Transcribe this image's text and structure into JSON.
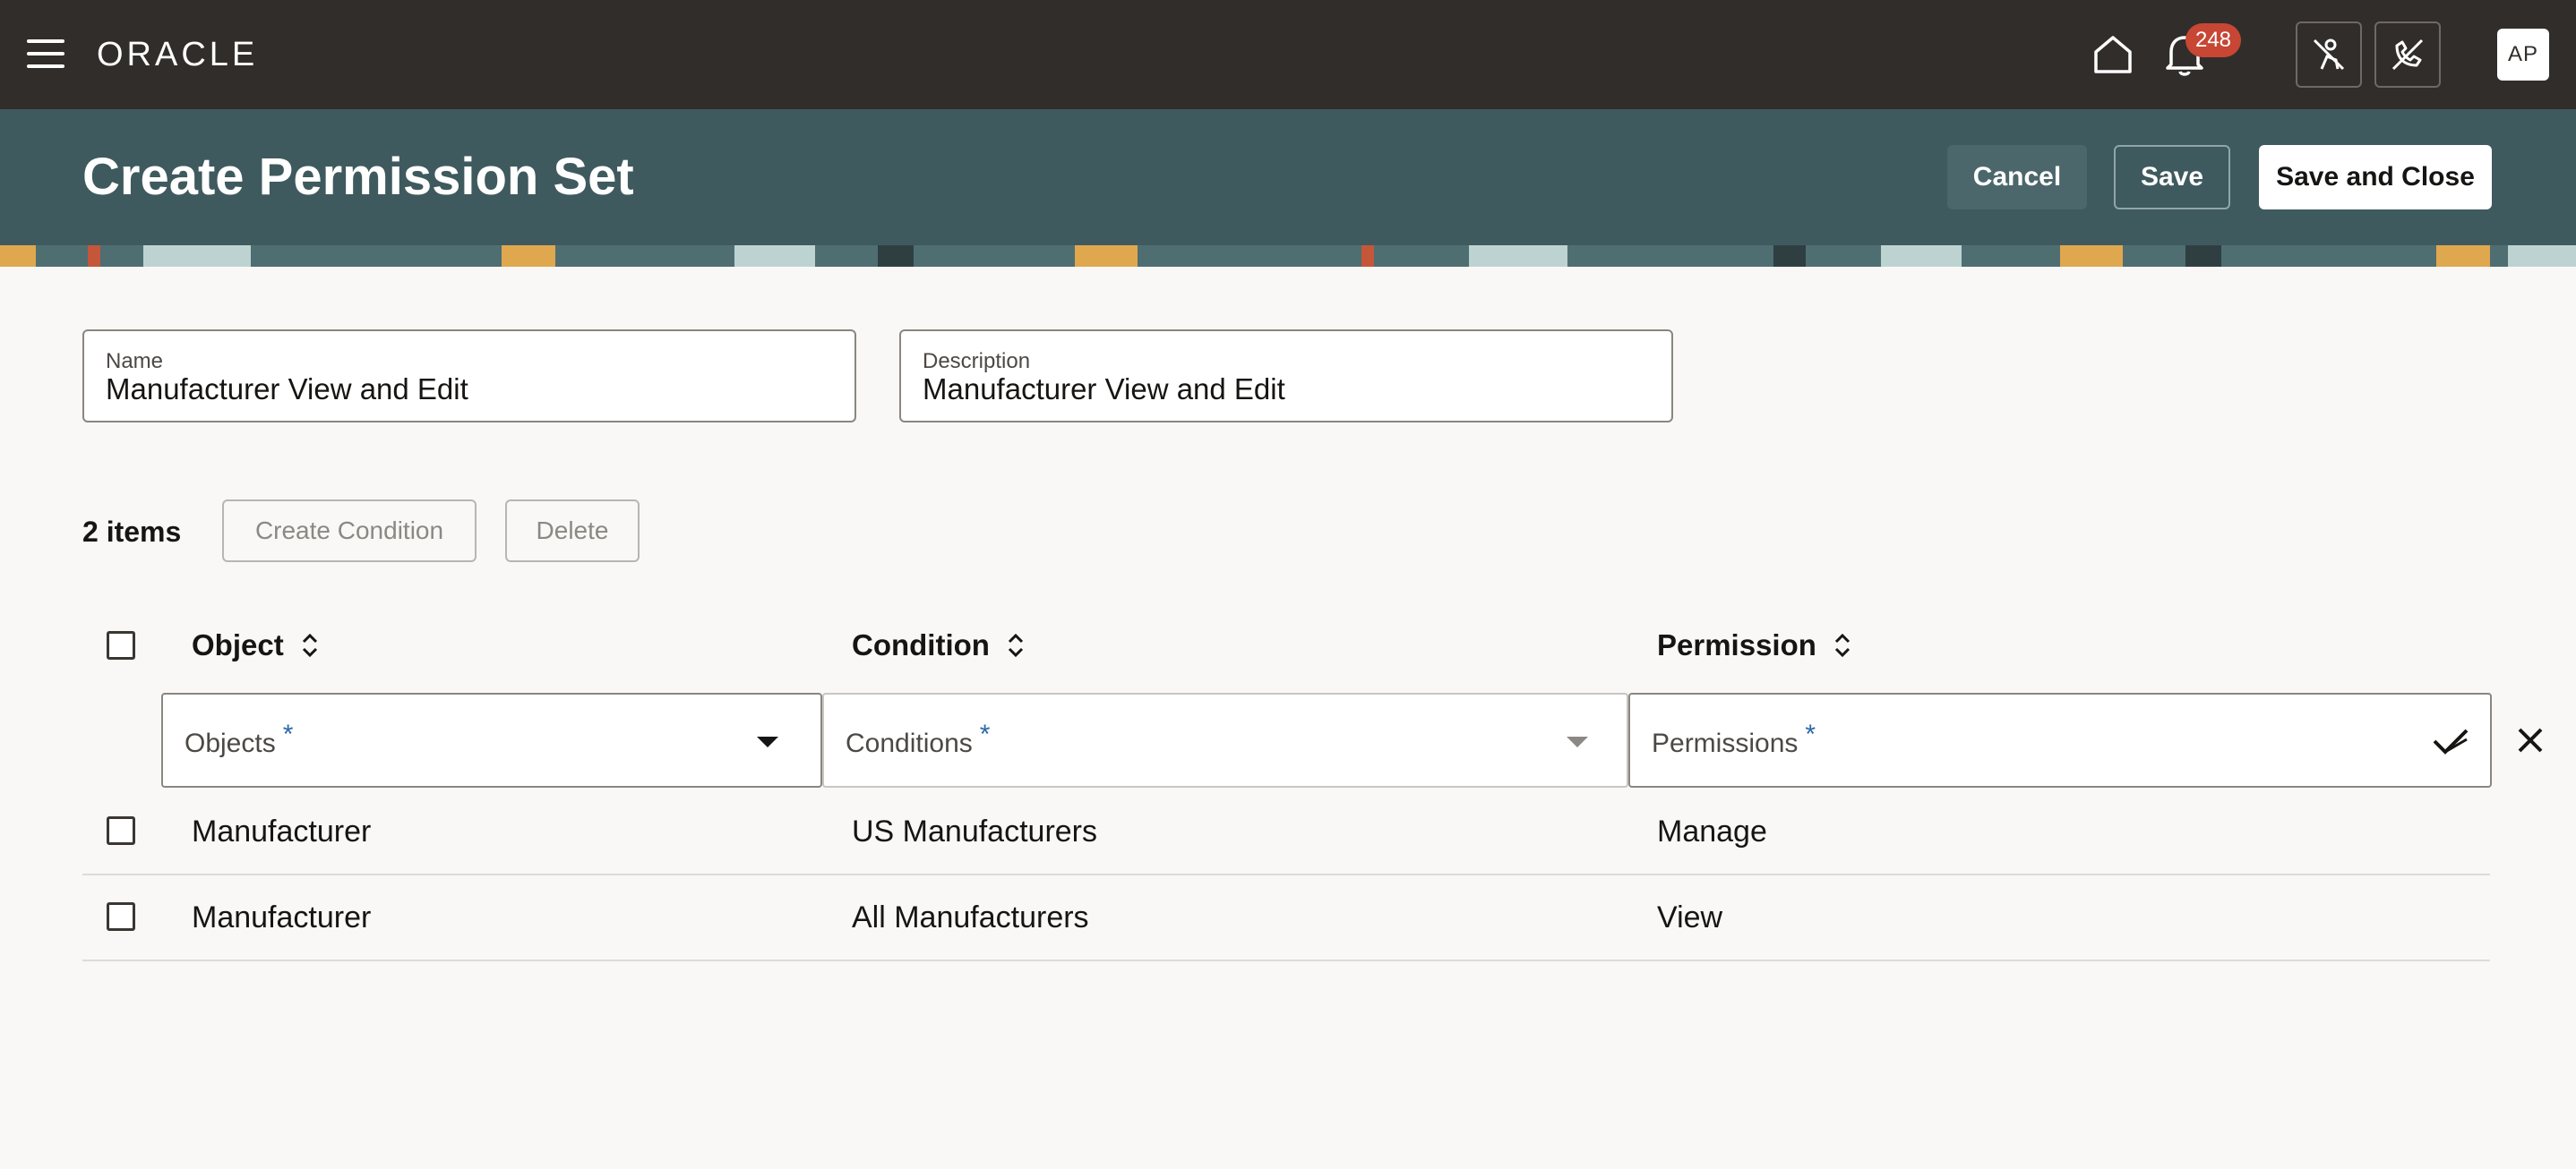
{
  "topbar": {
    "logo": "ORACLE",
    "notification_count": "248",
    "avatar_initials": "AP"
  },
  "header": {
    "title": "Create Permission Set",
    "cancel_label": "Cancel",
    "save_label": "Save",
    "save_close_label": "Save and Close"
  },
  "form": {
    "name_label": "Name",
    "name_value": "Manufacturer View and Edit",
    "description_label": "Description",
    "description_value": "Manufacturer View and Edit"
  },
  "toolbar": {
    "items_count": "2 items",
    "create_condition_label": "Create Condition",
    "delete_label": "Delete"
  },
  "table": {
    "columns": [
      "Object",
      "Condition",
      "Permission"
    ],
    "filters": {
      "objects_label": "Objects",
      "conditions_label": "Conditions",
      "permissions_label": "Permissions",
      "required_marker": "*"
    },
    "rows": [
      {
        "object": "Manufacturer",
        "condition": "US Manufacturers",
        "permission": "Manage"
      },
      {
        "object": "Manufacturer",
        "condition": "All Manufacturers",
        "permission": "View"
      }
    ]
  },
  "colors": {
    "topbar_bg": "#312d2a",
    "header_bg": "#3f5a5e",
    "badge_bg": "#c74634",
    "required_marker": "#2b6aa6"
  }
}
